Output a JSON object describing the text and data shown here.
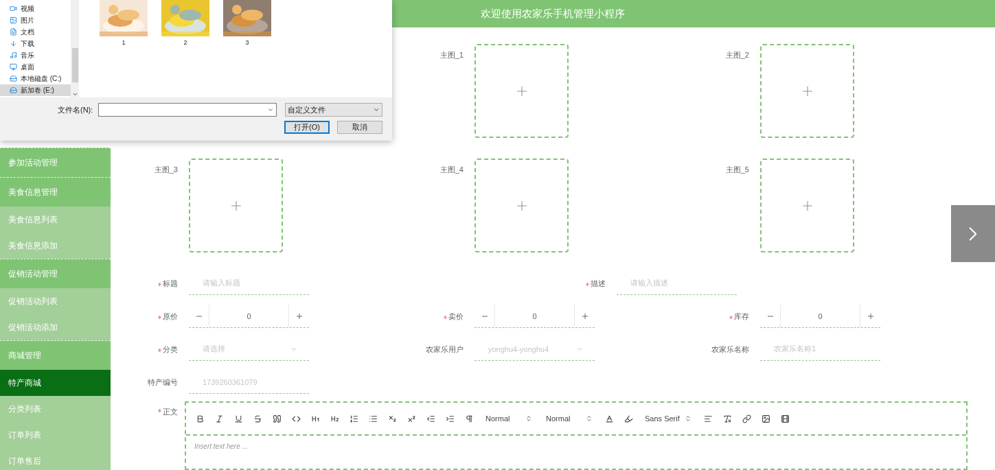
{
  "header": {
    "title": "欢迎使用农家乐手机管理小程序"
  },
  "sidebar": {
    "groups": [
      {
        "label": "参加活动管理"
      },
      {
        "label": "美食信息管理",
        "children": [
          {
            "label": "美食信息列表",
            "selected": false
          },
          {
            "label": "美食信息添加",
            "selected": false
          }
        ]
      },
      {
        "label": "促销活动管理",
        "children": [
          {
            "label": "促销活动列表",
            "selected": false
          },
          {
            "label": "促销活动添加",
            "selected": false
          }
        ]
      },
      {
        "label": "商城管理",
        "children": [
          {
            "label": "特产商城",
            "selected": true
          },
          {
            "label": "分类列表",
            "selected": false
          },
          {
            "label": "订单列表",
            "selected": false
          },
          {
            "label": "订单售后",
            "selected": false
          }
        ]
      }
    ]
  },
  "images": [
    {
      "label": "主图_1"
    },
    {
      "label": "主图_2"
    },
    {
      "label": "主图_3"
    },
    {
      "label": "主图_4"
    },
    {
      "label": "主图_5"
    }
  ],
  "form": {
    "rows": [
      {
        "fields": [
          {
            "kind": "text",
            "label": "标题",
            "required": true,
            "placeholder": "请输入标题"
          },
          {
            "kind": "text",
            "label": "描述",
            "required": true,
            "placeholder": "请输入描述"
          }
        ]
      },
      {
        "fields": [
          {
            "kind": "number",
            "label": "原价",
            "required": true,
            "value": "0"
          },
          {
            "kind": "number",
            "label": "卖价",
            "required": true,
            "value": "0"
          },
          {
            "kind": "number",
            "label": "库存",
            "required": true,
            "value": "0"
          }
        ]
      },
      {
        "fields": [
          {
            "kind": "select",
            "label": "分类",
            "required": true,
            "placeholder": "请选择"
          },
          {
            "kind": "select",
            "label": "农家乐用户",
            "required": false,
            "value": "yonghu4-yonghu4",
            "disabled": true
          },
          {
            "kind": "text",
            "label": "农家乐名称",
            "required": false,
            "value": "农家乐名称1",
            "disabled": true
          }
        ]
      },
      {
        "fields": [
          {
            "kind": "text",
            "label": "特产编号",
            "required": false,
            "value": "1739260361079",
            "disabled": true
          }
        ]
      }
    ]
  },
  "editor": {
    "label": "正文",
    "required": true,
    "placeholder": "Insert text here ...",
    "toolbar": [
      {
        "kind": "button"
      },
      {
        "kind": "button"
      },
      {
        "kind": "button"
      },
      {
        "kind": "button"
      },
      {
        "kind": "button"
      },
      {
        "kind": "button"
      },
      {
        "kind": "button"
      },
      {
        "kind": "button"
      },
      {
        "kind": "button"
      },
      {
        "kind": "button"
      },
      {
        "kind": "button"
      },
      {
        "kind": "button"
      },
      {
        "kind": "button"
      },
      {
        "kind": "button"
      },
      {
        "kind": "button"
      },
      {
        "kind": "select",
        "value": "Normal"
      },
      {
        "kind": "select",
        "value": "Normal"
      },
      {
        "kind": "button"
      },
      {
        "kind": "button"
      },
      {
        "kind": "select",
        "value": "Sans Serif"
      },
      {
        "kind": "button"
      },
      {
        "kind": "button"
      },
      {
        "kind": "button"
      },
      {
        "kind": "button"
      },
      {
        "kind": "button"
      }
    ]
  },
  "dialog": {
    "nav": [
      {
        "label": "视频",
        "selected": false
      },
      {
        "label": "图片",
        "selected": false
      },
      {
        "label": "文档",
        "selected": false
      },
      {
        "label": "下载",
        "selected": false
      },
      {
        "label": "音乐",
        "selected": false
      },
      {
        "label": "桌面",
        "selected": false
      },
      {
        "label": "本地磁盘 (C:)",
        "selected": false
      },
      {
        "label": "新加卷 (E:)",
        "selected": true
      }
    ],
    "files": [
      {
        "name": "1",
        "kind": "picture"
      },
      {
        "name": "2",
        "kind": "picture"
      },
      {
        "name": "3",
        "kind": "picture"
      }
    ],
    "filename_label": "文件名(N):",
    "filter": "自定义文件",
    "buttons": [
      {
        "label": "打开(O)",
        "selected": true
      },
      {
        "label": "取消",
        "selected": false
      }
    ]
  }
}
